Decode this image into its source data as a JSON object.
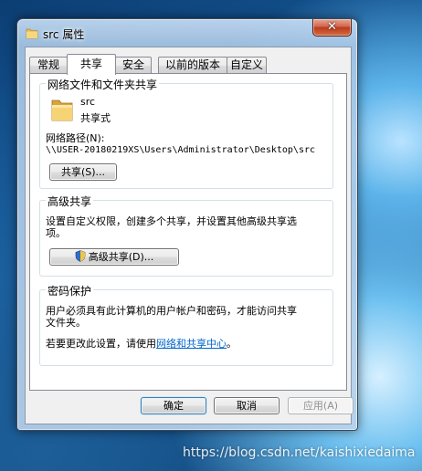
{
  "window": {
    "title": "src 属性",
    "close_glyph": "✕"
  },
  "tabs": [
    {
      "label": "常规",
      "active": false
    },
    {
      "label": "共享",
      "active": true
    },
    {
      "label": "安全",
      "active": false
    },
    {
      "label": "以前的版本",
      "active": false
    },
    {
      "label": "自定义",
      "active": false
    }
  ],
  "network_sharing": {
    "title": "网络文件和文件夹共享",
    "folder_name": "src",
    "folder_status": "共享式",
    "path_label": "网络路径(N):",
    "path_value": "\\\\USER-20180219XS\\Users\\Administrator\\Desktop\\src",
    "share_button": "共享(S)..."
  },
  "advanced_sharing": {
    "title": "高级共享",
    "description_line1": "设置自定义权限，创建多个共享，并设置其他高级共享选",
    "description_line2": "项。",
    "button": "高级共享(D)..."
  },
  "password_protection": {
    "title": "密码保护",
    "description_line1": "用户必须具有此计算机的用户帐户和密码，才能访问共享",
    "description_line2": "文件夹。",
    "change_prefix": "若要更改此设置，请使用",
    "change_link": "网络和共享中心",
    "change_suffix": "。"
  },
  "footer": {
    "ok": "确定",
    "cancel": "取消",
    "apply": "应用(A)"
  },
  "watermark": "https://blog.csdn.net/kaishixiedaima",
  "colors": {
    "link": "#0066cc",
    "folder": "#f2c94c"
  }
}
